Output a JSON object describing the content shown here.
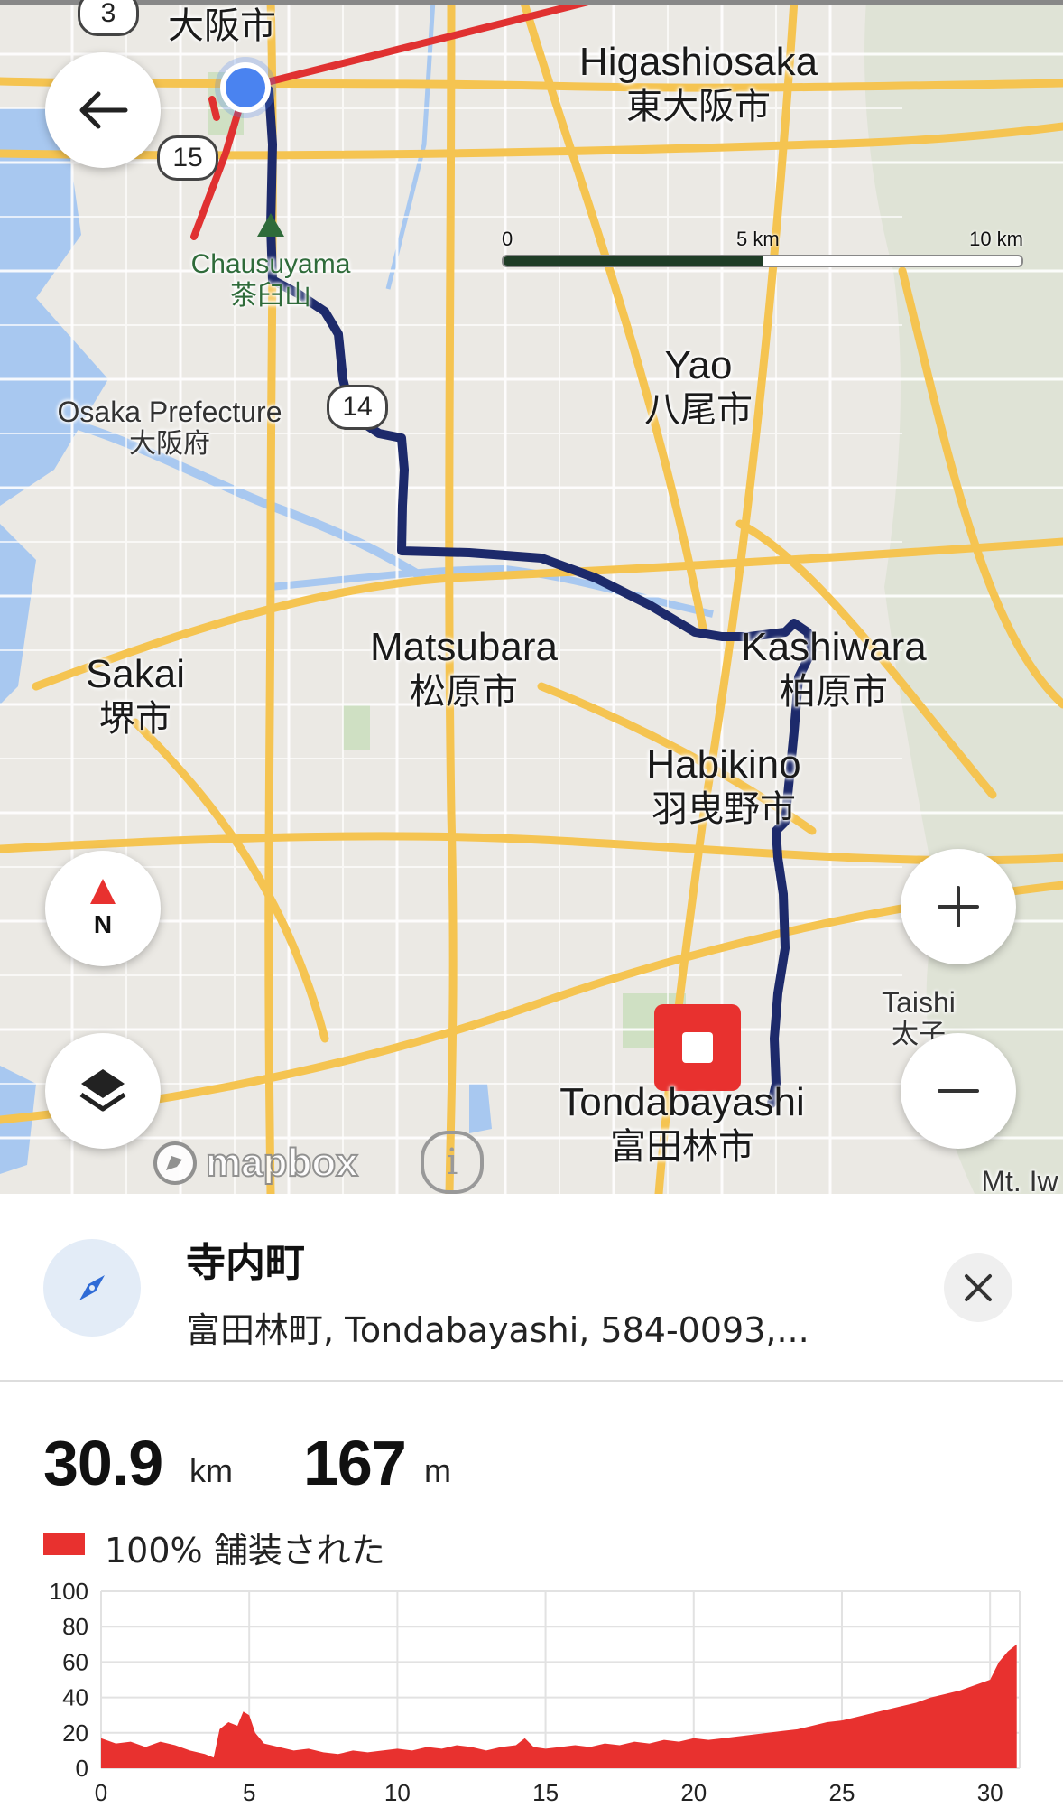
{
  "map": {
    "labels": {
      "osaka_city": "大阪市",
      "higashiosaka_en": "Higashiosaka",
      "higashiosaka_ja": "東大阪市",
      "chausuyama_en": "Chausuyama",
      "chausuyama_ja": "茶臼山",
      "yao_en": "Yao",
      "yao_ja": "八尾市",
      "osaka_pref_en": "Osaka Prefecture",
      "osaka_pref_ja": "大阪府",
      "matsubara_en": "Matsubara",
      "matsubara_ja": "松原市",
      "kashiwara_en": "Kashiwara",
      "kashiwara_ja": "柏原市",
      "sakai_en": "Sakai",
      "sakai_ja": "堺市",
      "habikino_en": "Habikino",
      "habikino_ja": "羽曳野市",
      "taishi_en": "Taishi",
      "taishi_ja": "太子",
      "tondabayashi_en": "Tondabayashi",
      "tondabayashi_ja": "富田林市",
      "mt_iw": "Mt. Iw"
    },
    "road_shields": [
      "3",
      "15",
      "14"
    ],
    "scale": {
      "t0": "0",
      "t1": "5 km",
      "t2": "10 km"
    },
    "attribution": "mapbox",
    "compass_label": "N",
    "colors": {
      "route": "#1d2a6b",
      "alt_route": "#e03131",
      "marker": "#e8312f",
      "location": "#4a83f0",
      "water": "#a8c8f0",
      "road_major": "#f5c451"
    }
  },
  "controls": {
    "back": "back-arrow-icon",
    "compass": "compass-icon",
    "layers": "layers-icon",
    "zoom_in": "plus-icon",
    "zoom_out": "minus-icon"
  },
  "place": {
    "title": "寺内町",
    "address": "富田林町, Tondabayashi, 584-0093,..."
  },
  "stats": {
    "distance_value": "30.9",
    "distance_unit": "km",
    "elevation_value": "167",
    "elevation_unit": "m"
  },
  "surface": {
    "label": "100% 舗装された",
    "color": "#e8312f"
  },
  "chart_data": {
    "type": "area",
    "title": "",
    "xlabel": "",
    "ylabel": "",
    "xlim": [
      0,
      31
    ],
    "ylim": [
      0,
      100
    ],
    "x_ticks": [
      "0",
      "5",
      "10",
      "15",
      "20",
      "25",
      "30"
    ],
    "y_ticks": [
      "100",
      "80",
      "60",
      "40",
      "20",
      "0"
    ],
    "grid": true,
    "series": [
      {
        "color": "#e8312f",
        "x": [
          0,
          0.5,
          1,
          1.5,
          2,
          2.5,
          3,
          3.5,
          3.8,
          4,
          4.3,
          4.6,
          4.8,
          5,
          5.2,
          5.5,
          6,
          6.5,
          7,
          7.5,
          8,
          8.5,
          9,
          9.5,
          10,
          10.5,
          11,
          11.5,
          12,
          12.5,
          13,
          13.5,
          14,
          14.3,
          14.6,
          15,
          15.5,
          16,
          16.5,
          17,
          17.5,
          18,
          18.5,
          19,
          19.5,
          20,
          20.5,
          21,
          21.5,
          22,
          22.5,
          23,
          23.5,
          24,
          24.5,
          25,
          25.5,
          26,
          26.5,
          27,
          27.5,
          28,
          28.5,
          29,
          29.5,
          30,
          30.3,
          30.6,
          30.9
        ],
        "y": [
          17,
          14,
          15,
          12,
          15,
          13,
          10,
          8,
          6,
          22,
          26,
          24,
          32,
          30,
          20,
          14,
          12,
          10,
          11,
          9,
          8,
          10,
          9,
          10,
          11,
          10,
          12,
          11,
          13,
          12,
          10,
          12,
          13,
          17,
          12,
          11,
          12,
          13,
          12,
          14,
          13,
          15,
          14,
          16,
          15,
          17,
          16,
          17,
          18,
          19,
          20,
          21,
          22,
          24,
          26,
          27,
          29,
          31,
          33,
          35,
          37,
          40,
          42,
          44,
          47,
          50,
          60,
          66,
          70
        ]
      }
    ]
  }
}
